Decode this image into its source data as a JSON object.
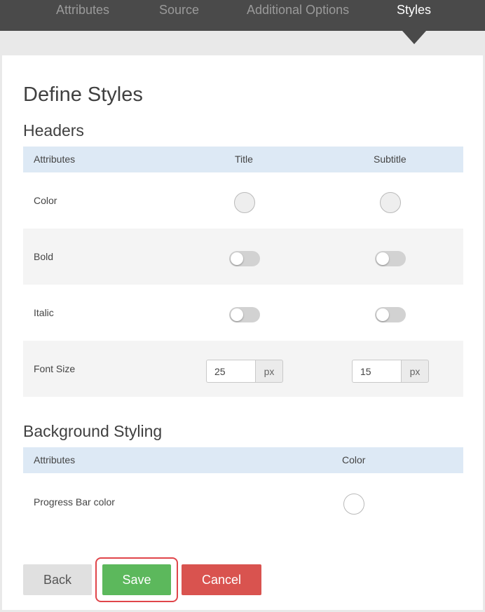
{
  "nav": {
    "tabs": [
      {
        "label": "Attributes"
      },
      {
        "label": "Source"
      },
      {
        "label": "Additional Options"
      },
      {
        "label": "Styles",
        "active": true
      }
    ]
  },
  "page": {
    "title": "Define Styles"
  },
  "headers_section": {
    "title": "Headers",
    "columns": [
      "Attributes",
      "Title",
      "Subtitle"
    ],
    "rows": {
      "color": {
        "label": "Color"
      },
      "bold": {
        "label": "Bold",
        "title_on": false,
        "subtitle_on": false
      },
      "italic": {
        "label": "Italic",
        "title_on": false,
        "subtitle_on": false
      },
      "font_size": {
        "label": "Font Size",
        "title_value": "25",
        "subtitle_value": "15",
        "unit": "px"
      }
    }
  },
  "background_section": {
    "title": "Background Styling",
    "columns": [
      "Attributes",
      "Color"
    ],
    "rows": {
      "progress_bar": {
        "label": "Progress Bar color"
      }
    }
  },
  "actions": {
    "back_label": "Back",
    "save_label": "Save",
    "cancel_label": "Cancel"
  },
  "colors": {
    "nav_bg": "#4a4a4a",
    "header_row_bg": "#dde9f5",
    "save": "#5cb85c",
    "cancel": "#d9534f",
    "focus_ring": "#e0454a"
  }
}
